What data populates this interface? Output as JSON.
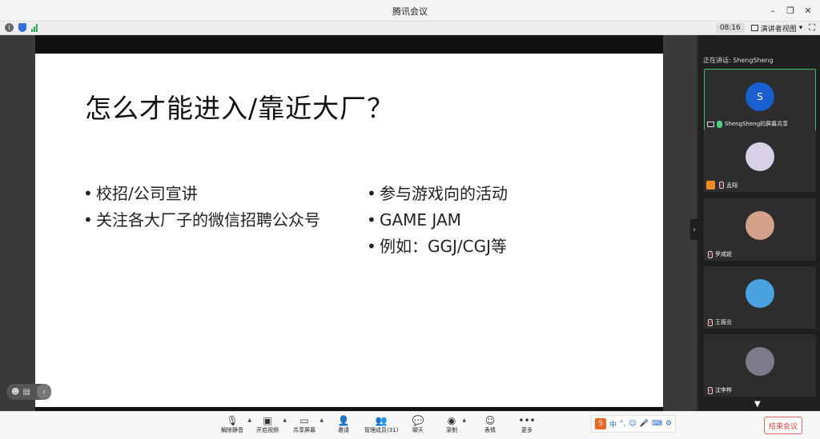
{
  "window": {
    "title": "腾讯会议"
  },
  "infobar": {
    "time": "08:16",
    "view_mode": "演讲者视图"
  },
  "slide": {
    "title": "怎么才能进入/靠近大厂？",
    "left_items": [
      "校招/公司宣讲",
      "关注各大厂子的微信招聘公众号"
    ],
    "right_items": [
      "参与游戏向的活动",
      "GAME   JAM",
      "例如：GGJ/CGJ等"
    ]
  },
  "sidebar": {
    "speaking": "正在讲话: ShengSheng",
    "participants": [
      {
        "name": "ShengSheng的屏幕共享",
        "initial": "S",
        "avatar_color": "#1a5fd0"
      },
      {
        "name": "孟翔",
        "initial": "",
        "avatar_color": "#d8d0e6"
      },
      {
        "name": "罗咸妮",
        "initial": "",
        "avatar_color": "#d6a18a"
      },
      {
        "name": "王振业",
        "initial": "",
        "avatar_color": "#4aa3e0"
      },
      {
        "name": "沈李桦",
        "initial": "",
        "avatar_color": "#7f7a8a"
      }
    ]
  },
  "toolbar": {
    "unmute": "解除静音",
    "video": "开启视频",
    "share": "共享屏幕",
    "invite": "邀请",
    "members": "管理成员(31)",
    "chat": "聊天",
    "record": "录制",
    "reactions": "表情",
    "more": "更多",
    "end": "结束会议"
  },
  "ime": {
    "lang": "中"
  }
}
